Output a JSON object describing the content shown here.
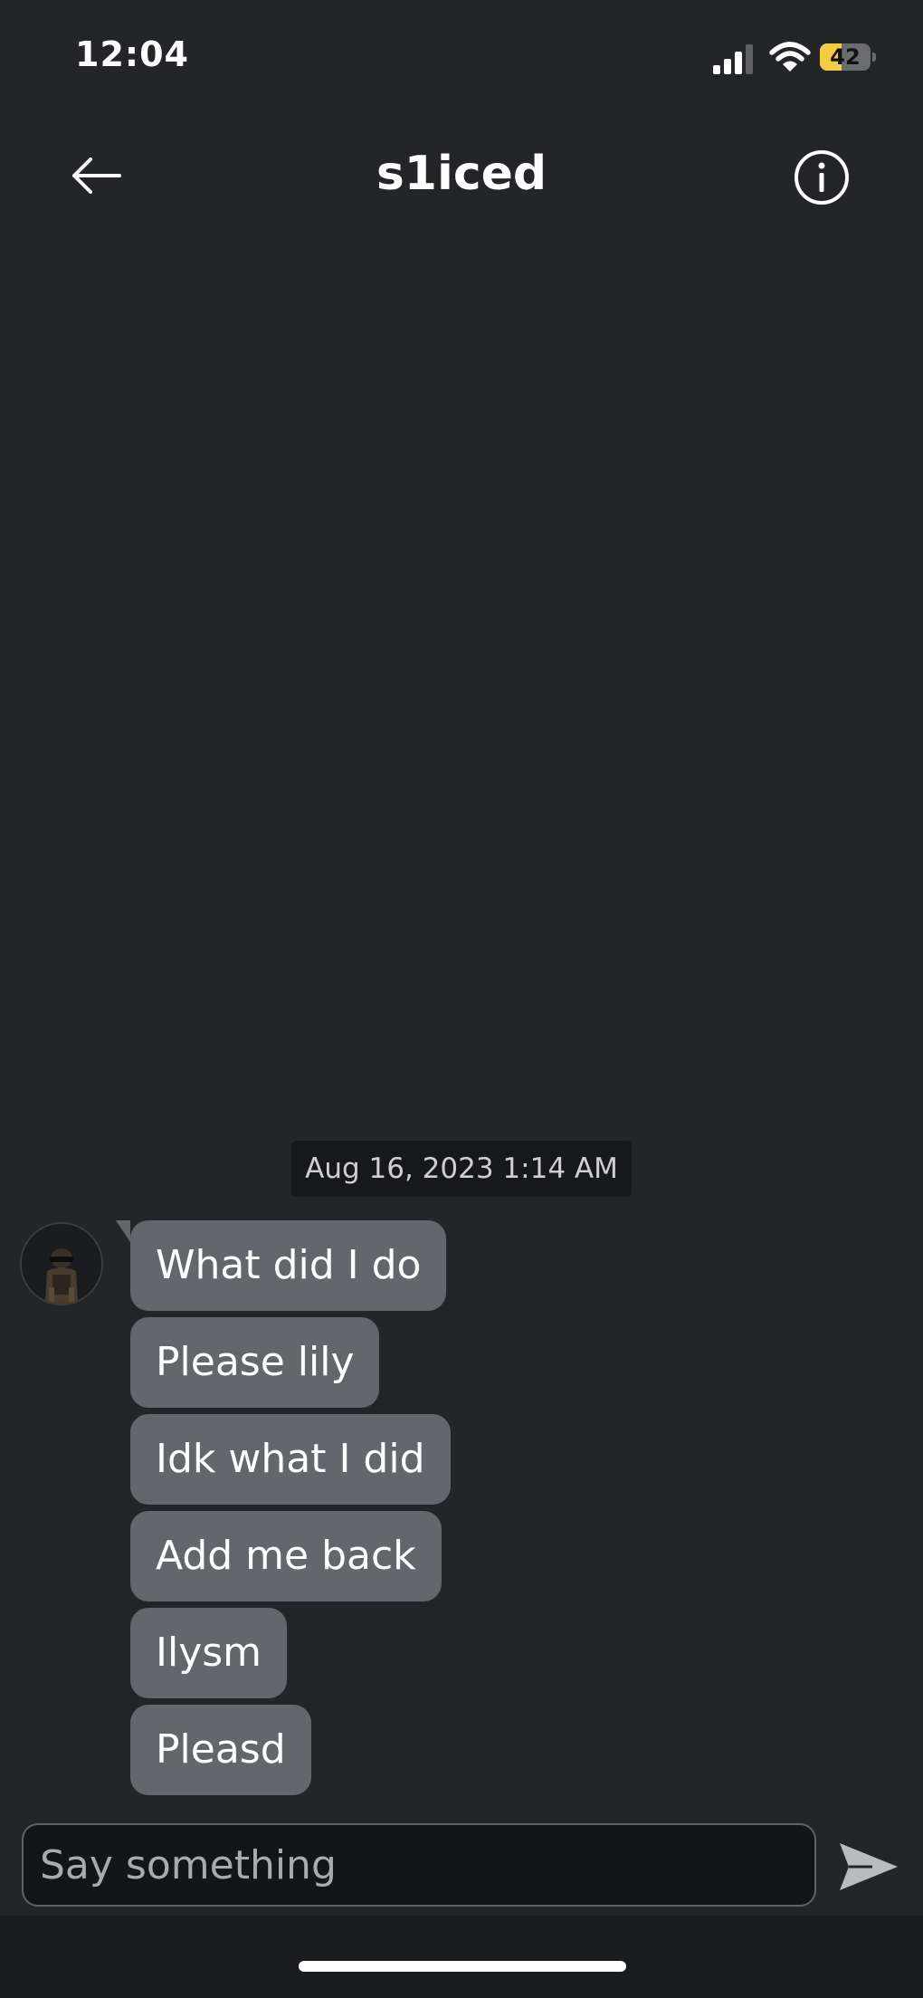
{
  "status_bar": {
    "time": "12:04",
    "battery_level": "42",
    "battery_fraction": 0.42,
    "icons": [
      "cellular-signal-icon",
      "wifi-icon",
      "battery-icon"
    ]
  },
  "header": {
    "title": "s1iced",
    "back_icon": "arrow-left-icon",
    "info_icon": "info-icon"
  },
  "conversation": {
    "date_separator": "Aug 16, 2023 1:14 AM",
    "messages": [
      {
        "text": "What did I do"
      },
      {
        "text": "Please lily"
      },
      {
        "text": "Idk what I did"
      },
      {
        "text": "Add me back"
      },
      {
        "text": "Ilysm"
      },
      {
        "text": "Pleasd"
      }
    ]
  },
  "composer": {
    "placeholder": "Say something",
    "value": "",
    "send_icon": "send-icon"
  },
  "colors": {
    "background": "#232528",
    "bubble": "#63666a",
    "battery_accent": "#f4cc42"
  }
}
